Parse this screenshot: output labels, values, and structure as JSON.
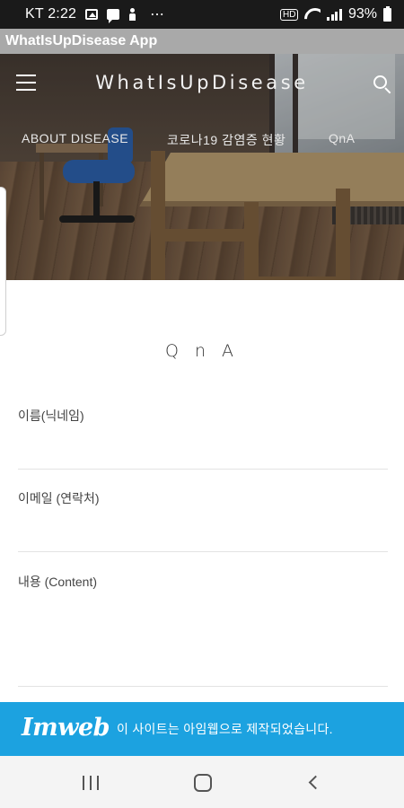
{
  "status_bar": {
    "carrier_time": "KT 2:22",
    "more": "⋯",
    "signal_label": "HD",
    "battery": "93%"
  },
  "app_bar": {
    "title": "WhatIsUpDisease App"
  },
  "header": {
    "site_title": "WhatIsUpDisease",
    "menu": [
      {
        "label": "ABOUT DISEASE"
      },
      {
        "label": "코로나19 감염증 현황"
      },
      {
        "label": "QnA"
      }
    ]
  },
  "form": {
    "title": "Q n A",
    "fields": [
      {
        "label": "이름(닉네임)",
        "value": ""
      },
      {
        "label": "이메일 (연락처)",
        "value": ""
      },
      {
        "label": "내용 (Content)",
        "value": ""
      }
    ]
  },
  "banner": {
    "logo": "Imweb",
    "text": "이 사이트는 아임웹으로 제작되었습니다."
  },
  "icons": {
    "menu": "hamburger-icon",
    "search": "search-icon",
    "recents": "recents-icon",
    "home": "home-icon",
    "back": "back-icon"
  },
  "colors": {
    "banner": "#1ca2e0",
    "status_bar": "#1a1a1a",
    "app_bar": "#a9a9a9"
  }
}
